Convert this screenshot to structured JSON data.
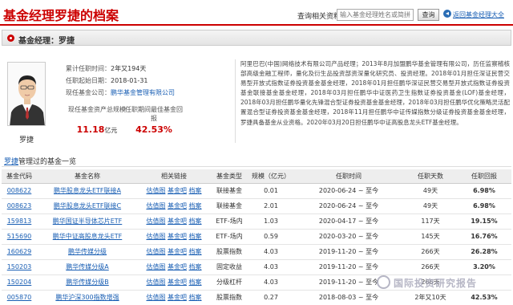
{
  "header": {
    "title": "基金经理罗捷的档案",
    "search_label": "查询相关资料：",
    "search_placeholder": "输入基金经理姓名或简拼",
    "search_button": "查询",
    "back_link": "返回基金经理大全"
  },
  "section": {
    "title": "基金经理：罗捷"
  },
  "profile": {
    "name": "罗捷",
    "tenure_label": "累计任职时间：",
    "tenure_value": "2年又194天",
    "start_label": "任职起始日期：",
    "start_value": "2018-01-31",
    "company_label": "现任基金公司：",
    "company_value": "鹏华基金管理有限公司",
    "assets_label": "现任基金资产总规模",
    "assets_value": "11.18",
    "assets_unit": "亿元",
    "best_label": "任职期间最佳基金回报",
    "best_value": "42.53%",
    "bio": "阿里巴巴(中国)网络技术有限公司产品经理；2013年8月加盟鹏华基金管理有限公司，历任监察稽核部高级金融工程师，量化及衍生品投资部资深量化研究员、投资经理。2018年01月担任深证民营交易型开放式指数证券投资基金基金经理，2018年01月担任鹏华深证民营交易型开放式指数证券投资基金联接基金基金经理，2018年03月担任鹏华中证医药卫生指数证券投资基金(LOF)基金经理，2018年03月担任鹏华量化先锋混合型证券投资基金基金经理，2018年03月担任鹏华优化策略灵活配置混合型证券投资基金基金经理，2018年11月担任鹏华中证传媒指数分级证券投资基金基金经理，罗捷具备基金从业资格。2020年03月20日担任鹏华中证高股息龙头ETF基金经理。"
  },
  "funds_heading": {
    "name": "罗捷",
    "suffix": "管理过的基金一览"
  },
  "table": {
    "headers": [
      "基金代码",
      "基金名称",
      "相关链接",
      "基金类型",
      "规模（亿元）",
      "任职时间",
      "任职天数",
      "任职回报"
    ],
    "rows": [
      {
        "code": "008622",
        "name": "鹏华股息龙头ETF联接A",
        "links": [
          "估值图",
          "基金吧",
          "档案"
        ],
        "type": "联接基金",
        "size": "0.01",
        "period": "2020-06-24 ~ 至今",
        "days": "49天",
        "ret": "6.98%"
      },
      {
        "code": "008623",
        "name": "鹏华股息龙头ETF联接C",
        "links": [
          "估值图",
          "基金吧",
          "档案"
        ],
        "type": "联接基金",
        "size": "2.01",
        "period": "2020-06-24 ~ 至今",
        "days": "49天",
        "ret": "6.98%"
      },
      {
        "code": "159813",
        "name": "鹏华国证半导体芯片ETF",
        "links": [
          "估值图",
          "基金吧",
          "档案"
        ],
        "type": "ETF-场内",
        "size": "1.03",
        "period": "2020-04-17 ~ 至今",
        "days": "117天",
        "ret": "19.15%"
      },
      {
        "code": "515690",
        "name": "鹏华中证高股息龙头ETF",
        "links": [
          "估值图",
          "基金吧",
          "档案"
        ],
        "type": "ETF-场内",
        "size": "0.59",
        "period": "2020-03-20 ~ 至今",
        "days": "145天",
        "ret": "16.76%"
      },
      {
        "code": "160629",
        "name": "鹏华传媒分级",
        "links": [
          "估值图",
          "基金吧",
          "档案"
        ],
        "type": "股票指数",
        "size": "4.03",
        "period": "2019-11-20 ~ 至今",
        "days": "266天",
        "ret": "26.28%"
      },
      {
        "code": "150203",
        "name": "鹏华传媒分级A",
        "links": [
          "估值图",
          "基金吧",
          "档案"
        ],
        "type": "固定收益",
        "size": "4.03",
        "period": "2019-11-20 ~ 至今",
        "days": "266天",
        "ret": "3.20%"
      },
      {
        "code": "150204",
        "name": "鹏华传媒分级B",
        "links": [
          "估值图",
          "基金吧",
          "档案"
        ],
        "type": "分级杠杆",
        "size": "4.03",
        "period": "2019-11-20 ~ 至今",
        "days": "266天",
        "ret": ""
      },
      {
        "code": "005870",
        "name": "鹏华沪深300指数增强",
        "links": [
          "估值图",
          "基金吧",
          "档案"
        ],
        "type": "股票指数",
        "size": "0.27",
        "period": "2018-08-03 ~ 至今",
        "days": "2年又10天",
        "ret": "42.53%"
      }
    ]
  },
  "watermark": {
    "text": "国际投资研究报告"
  }
}
